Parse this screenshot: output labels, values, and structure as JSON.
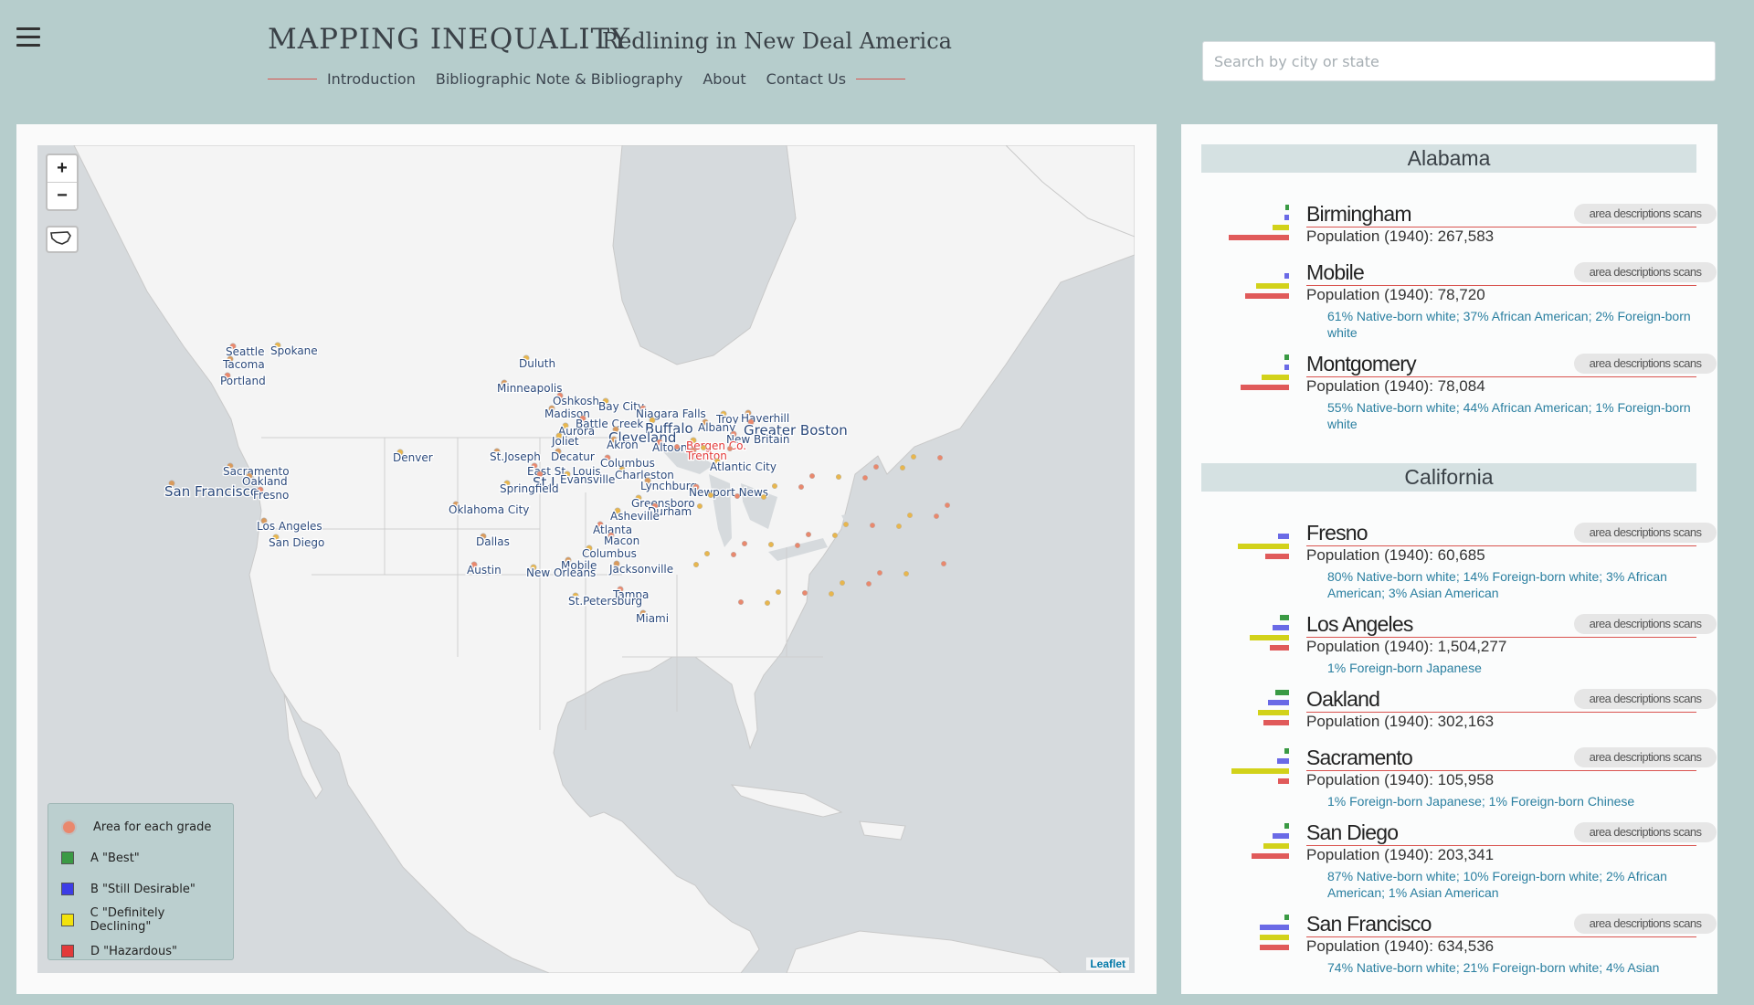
{
  "header": {
    "menu_icon": "hamburger-menu-icon",
    "title": "MAPPING INEQUALITY",
    "subtitle": "Redlining in New Deal America",
    "nav": [
      "Introduction",
      "Bibliographic Note & Bibliography",
      "About",
      "Contact Us"
    ]
  },
  "search": {
    "placeholder": "Search by city or state",
    "value": ""
  },
  "map": {
    "zoom_in": "+",
    "zoom_out": "−",
    "attribution": "Leaflet",
    "legend": [
      {
        "label": "Area for each grade",
        "color": "#e9886d"
      },
      {
        "label": "A \"Best\"",
        "color": "#3a9a44"
      },
      {
        "label": "B \"Still Desirable\"",
        "color": "#3d3de6"
      },
      {
        "label": "C \"Definitely Declining\"",
        "color": "#f2e20c"
      },
      {
        "label": "D \"Hazardous\"",
        "color": "#e23a3a"
      }
    ],
    "city_labels": [
      {
        "text": "Seattle"
      },
      {
        "text": "Spokane"
      },
      {
        "text": "Tacoma"
      },
      {
        "text": "Portland"
      },
      {
        "text": "Duluth"
      },
      {
        "text": "Minneapolis"
      },
      {
        "text": "Oshkosh"
      },
      {
        "text": "Bay City"
      },
      {
        "text": "Madison"
      },
      {
        "text": "Niagara Falls"
      },
      {
        "text": "Troy"
      },
      {
        "text": "Haverhill"
      },
      {
        "text": "Battle Creek"
      },
      {
        "text": "Buffalo"
      },
      {
        "text": "Albany"
      },
      {
        "text": "Greater Boston"
      },
      {
        "text": "Aurora"
      },
      {
        "text": "Cleveland"
      },
      {
        "text": "New Britain"
      },
      {
        "text": "Joliet"
      },
      {
        "text": "Akron"
      },
      {
        "text": "Altoona"
      },
      {
        "text": "Bergen Co."
      },
      {
        "text": "Decatur"
      },
      {
        "text": "Trenton"
      },
      {
        "text": "Denver"
      },
      {
        "text": "St.Joseph"
      },
      {
        "text": "Columbus"
      },
      {
        "text": "Atlantic City"
      },
      {
        "text": "Sacramento"
      },
      {
        "text": "East St. Louis"
      },
      {
        "text": "Charleston"
      },
      {
        "text": "Oakland"
      },
      {
        "text": "St.L"
      },
      {
        "text": "Evansville"
      },
      {
        "text": "San Francisco"
      },
      {
        "text": "Fresno"
      },
      {
        "text": "Springfield"
      },
      {
        "text": "Lynchburg"
      },
      {
        "text": "Newport News"
      },
      {
        "text": "Greensboro"
      },
      {
        "text": "Oklahoma City"
      },
      {
        "text": "Durham"
      },
      {
        "text": "Asheville"
      },
      {
        "text": "Los Angeles"
      },
      {
        "text": "Atlanta"
      },
      {
        "text": "San Diego"
      },
      {
        "text": "Dallas"
      },
      {
        "text": "Macon"
      },
      {
        "text": "Columbus"
      },
      {
        "text": "Mobile"
      },
      {
        "text": "Austin"
      },
      {
        "text": "New Orleans"
      },
      {
        "text": "Jacksonville"
      },
      {
        "text": "Tampa"
      },
      {
        "text": "St.Petersburg"
      },
      {
        "text": "Miami"
      }
    ]
  },
  "panel": {
    "states": [
      {
        "name": "Alabama",
        "cities": [
          {
            "name": "Birmingham",
            "population": "Population (1940): 267,583",
            "demographics": "",
            "scans_label": "area descriptions scans",
            "grade_shares": [
              0.06,
              0.08,
              0.28,
              1.0
            ]
          },
          {
            "name": "Mobile",
            "population": "Population (1940): 78,720",
            "demographics": "61% Native-born white; 37% African American; 2% Foreign-born white",
            "scans_label": "area descriptions scans",
            "grade_shares": [
              0.0,
              0.08,
              0.55,
              0.72
            ]
          },
          {
            "name": "Montgomery",
            "population": "Population (1940): 78,084",
            "demographics": "55% Native-born white; 44% African American; 1% Foreign-born white",
            "scans_label": "area descriptions scans",
            "grade_shares": [
              0.08,
              0.08,
              0.45,
              0.8
            ]
          }
        ]
      },
      {
        "name": "California",
        "cities": [
          {
            "name": "Fresno",
            "population": "Population (1940): 60,685",
            "demographics": "80% Native-born white; 14% Foreign-born white; 3% African American; 3% Asian American",
            "scans_label": "area descriptions scans",
            "grade_shares": [
              0.0,
              0.18,
              0.85,
              0.4
            ]
          },
          {
            "name": "Los Angeles",
            "population": "Population (1940): 1,504,277",
            "demographics": "1% Foreign-born Japanese",
            "scans_label": "area descriptions scans",
            "grade_shares": [
              0.15,
              0.28,
              0.65,
              0.32
            ]
          },
          {
            "name": "Oakland",
            "population": "Population (1940): 302,163",
            "demographics": "",
            "scans_label": "area descriptions scans",
            "grade_shares": [
              0.22,
              0.35,
              0.52,
              0.42
            ]
          },
          {
            "name": "Sacramento",
            "population": "Population (1940): 105,958",
            "demographics": "1% Foreign-born Japanese; 1% Foreign-born Chinese",
            "scans_label": "area descriptions scans",
            "grade_shares": [
              0.08,
              0.2,
              0.95,
              0.18
            ]
          },
          {
            "name": "San Diego",
            "population": "Population (1940): 203,341",
            "demographics": "87% Native-born white; 10% Foreign-born white; 2% African American; 1% Asian American",
            "scans_label": "area descriptions scans",
            "grade_shares": [
              0.08,
              0.28,
              0.42,
              0.62
            ]
          },
          {
            "name": "San Francisco",
            "population": "Population (1940): 634,536",
            "demographics": "74% Native-born white; 21% Foreign-born white; 4% Asian",
            "scans_label": "area descriptions scans",
            "grade_shares": [
              0.08,
              0.48,
              0.48,
              0.48
            ]
          }
        ]
      }
    ]
  }
}
